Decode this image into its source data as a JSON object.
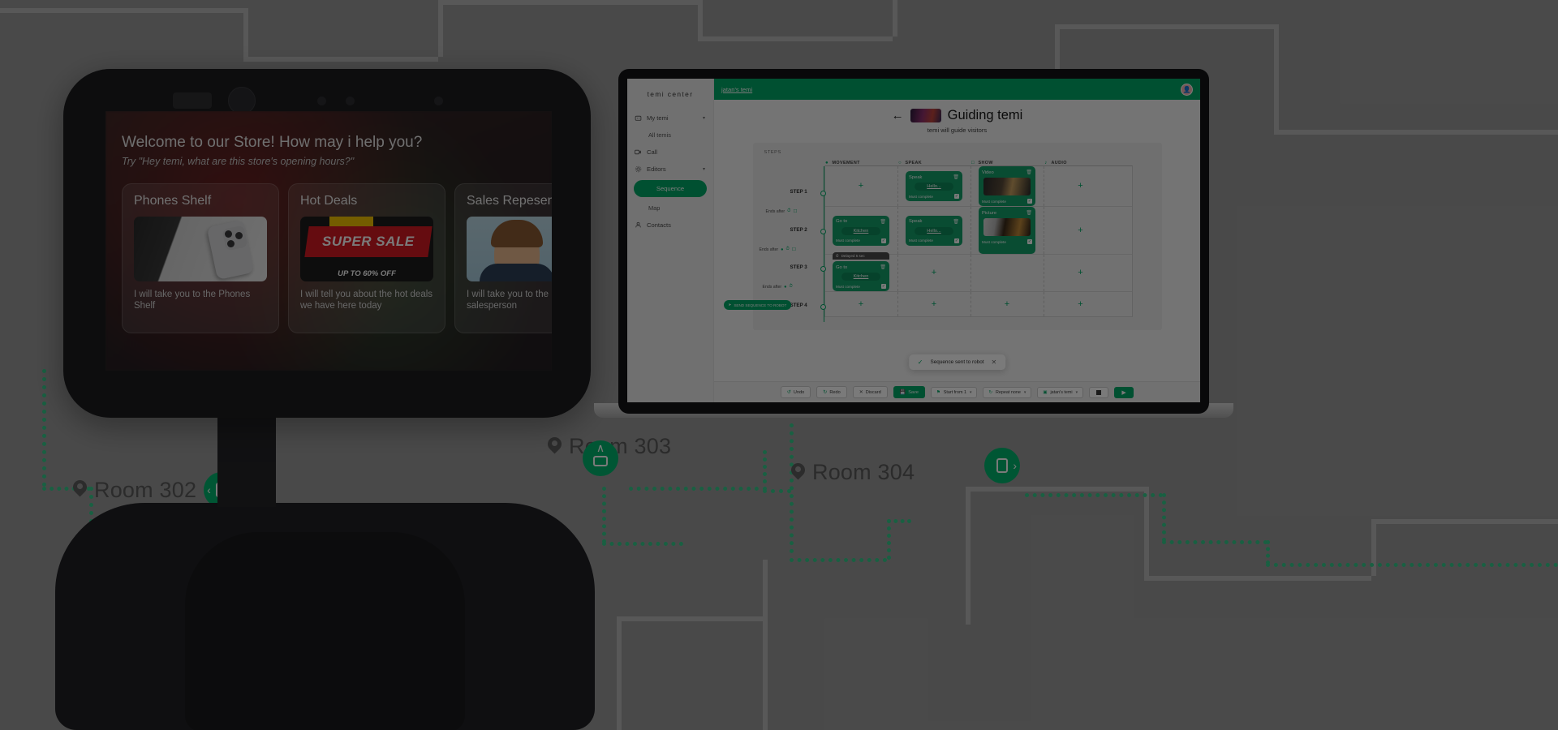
{
  "robot_screen": {
    "welcome_title": "Welcome to our Store! How may i help you?",
    "welcome_subtitle": "Try \"Hey temi, what are this store's opening hours?\"",
    "cards": [
      {
        "title": "Phones Shelf",
        "caption": "I will take you to the Phones Shelf",
        "image": "phone-photo"
      },
      {
        "title": "Hot Deals",
        "caption": "I will tell you about the hot deals we have here today",
        "image": "super-sale-banner",
        "banner_main": "SUPER SALE",
        "banner_sub": "UP TO 60% OFF"
      },
      {
        "title": "Sales Repesentative",
        "caption": "I will take you to the salesperson",
        "image": "person-photo"
      }
    ]
  },
  "floorplan": {
    "rooms": [
      {
        "label": "Room 302",
        "icon": "door-left-icon"
      },
      {
        "label": "Room 303",
        "icon": "elevator-up-icon"
      },
      {
        "label": "Room 304",
        "icon": "door-right-icon"
      }
    ]
  },
  "app": {
    "brand": "temi center",
    "topbar": {
      "title": "jatan's temi",
      "avatar_icon": "user-avatar"
    },
    "sidebar": [
      {
        "label": "My temi",
        "icon": "robot-icon",
        "caret": "▾",
        "type": "parent"
      },
      {
        "label": "All temis",
        "type": "sub"
      },
      {
        "label": "Call",
        "icon": "video-call-icon",
        "type": "item"
      },
      {
        "label": "Editors",
        "icon": "gear-icon",
        "caret": "▾",
        "type": "parent"
      },
      {
        "label": "Sequence",
        "type": "active"
      },
      {
        "label": "Map",
        "type": "sub"
      },
      {
        "label": "Contacts",
        "icon": "contacts-icon",
        "type": "item"
      }
    ],
    "page": {
      "back_icon": "back-arrow-icon",
      "title": "Guiding temi",
      "subtitle": "temi will guide visitors",
      "steps_label": "STEPS"
    },
    "columns": [
      {
        "label": "MOVEMENT",
        "icon": "location-pin-icon"
      },
      {
        "label": "SPEAK",
        "icon": "speech-icon"
      },
      {
        "label": "SHOW",
        "icon": "screen-icon"
      },
      {
        "label": "AUDIO",
        "icon": "music-note-icon"
      }
    ],
    "must_complete_label": "Must complete",
    "steps": [
      {
        "name": "STEP 1",
        "movement": null,
        "speak": {
          "title": "Speak",
          "value": "Hello...",
          "must_complete": true
        },
        "show": {
          "title": "Video",
          "media": "video-thumb",
          "must_complete": true
        },
        "audio": null,
        "ends_after": {
          "label": "Ends after",
          "icons": [
            "timer-0s-icon",
            "screen-icon"
          ]
        }
      },
      {
        "name": "STEP 2",
        "movement": {
          "title": "Go to",
          "value": "Kitchen",
          "must_complete": true
        },
        "speak": {
          "title": "Speak",
          "value": "Hello...",
          "must_complete": true
        },
        "show": {
          "title": "Picture",
          "media": "picture-thumb",
          "must_complete": true
        },
        "audio": null,
        "ends_after": {
          "label": "Ends after",
          "icons": [
            "location-pin-icon",
            "timer-0s-icon",
            "screen-icon"
          ]
        }
      },
      {
        "name": "STEP 3",
        "movement": {
          "title": "Go to",
          "value": "Kitchen",
          "must_complete": true,
          "badge": "Delayed 5 sec"
        },
        "speak": null,
        "show": null,
        "audio": null,
        "ends_after": {
          "label": "Ends after",
          "icons": [
            "location-pin-icon",
            "timer-0s-icon"
          ]
        }
      },
      {
        "name": "STEP 4",
        "movement": null,
        "speak": null,
        "show": null,
        "audio": null,
        "send_pill": "SEND SEQUENCE TO ROBOT"
      }
    ],
    "toast": {
      "icon": "check-icon",
      "message": "Sequence sent to robot",
      "close_icon": "close-icon"
    },
    "toolbar": {
      "undo": "Undo",
      "redo": "Redo",
      "discard": "Discard",
      "save": "Save",
      "start_from": "Start from 1",
      "repeat": "Repeat none",
      "robot": "jatan's temi",
      "stop_icon": "stop-icon",
      "play_icon": "play-icon"
    }
  },
  "colors": {
    "accent": "#00a866",
    "card": "#14a06a",
    "topbar": "#00a866",
    "dotted_path": "#35c98a"
  }
}
